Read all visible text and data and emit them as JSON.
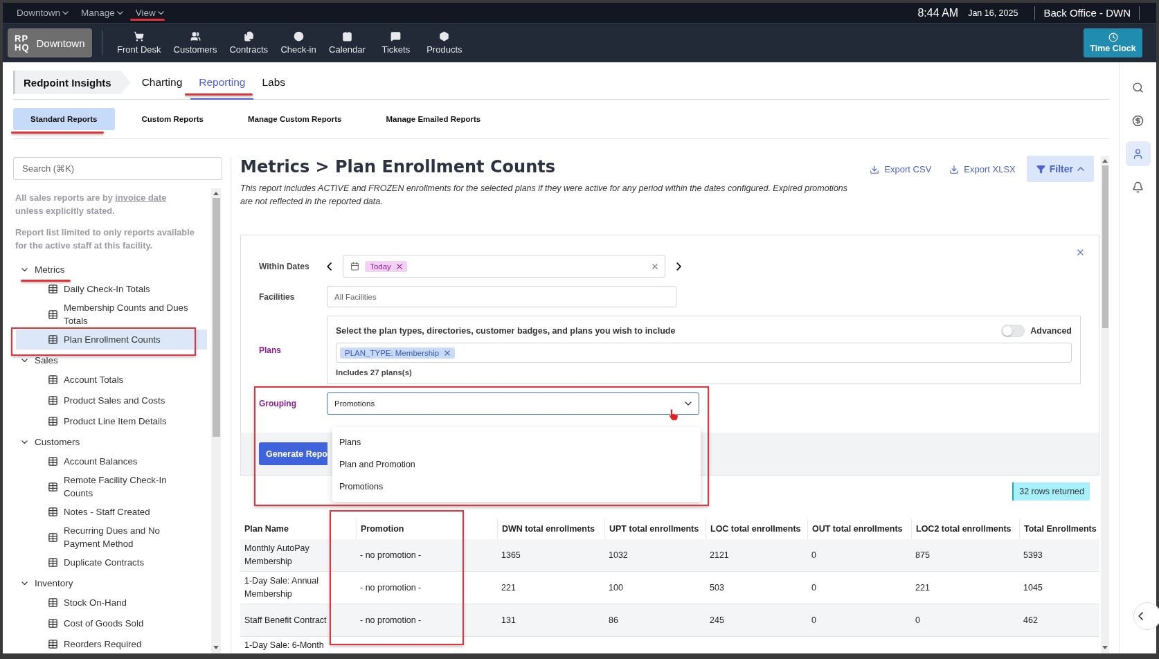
{
  "top_menu": [
    "Downtown",
    "Manage",
    "View"
  ],
  "clock": {
    "time": "8:44 AM",
    "date": "Jan 16, 2025"
  },
  "location": "Back Office - DWN",
  "brand": {
    "logo_top": "RP",
    "logo_bottom": "HQ",
    "name": "Downtown"
  },
  "nav": [
    "Front Desk",
    "Customers",
    "Contracts",
    "Check-in",
    "Calendar",
    "Tickets",
    "Products"
  ],
  "time_clock": "Time Clock",
  "rail": [
    {
      "selected": false
    },
    {
      "selected": false
    },
    {
      "selected": true
    },
    {
      "selected": false
    }
  ],
  "app_tabs": {
    "home": "Redpoint Insights",
    "tabs": [
      {
        "label": "Charting",
        "selected": false
      },
      {
        "label": "Reporting",
        "selected": true
      },
      {
        "label": "Labs",
        "selected": false
      }
    ]
  },
  "sub_tabs": [
    {
      "label": "Standard Reports",
      "selected": true
    },
    {
      "label": "Custom Reports",
      "selected": false
    },
    {
      "label": "Manage Custom Reports",
      "selected": false
    },
    {
      "label": "Manage Emailed Reports",
      "selected": false
    }
  ],
  "sidebar": {
    "search_placeholder": "Search (⌘K)",
    "note_1": {
      "before": "All sales reports are by ",
      "link": "invoice date",
      "after": " unless explicitly stated."
    },
    "note_2": "Report list limited to only reports available for the active staff at this facility.",
    "tree": [
      {
        "label": "Metrics",
        "expanded": true,
        "children": [
          {
            "label": "Daily Check-In Totals",
            "selected": false
          },
          {
            "label": "Membership Counts and Dues Totals",
            "selected": false
          },
          {
            "label": "Plan Enrollment Counts",
            "selected": true
          }
        ]
      },
      {
        "label": "Sales",
        "expanded": true,
        "children": [
          {
            "label": "Account Totals",
            "selected": false
          },
          {
            "label": "Product Sales and Costs",
            "selected": false
          },
          {
            "label": "Product Line Item Details",
            "selected": false
          }
        ]
      },
      {
        "label": "Customers",
        "expanded": true,
        "children": [
          {
            "label": "Account Balances",
            "selected": false
          },
          {
            "label": "Remote Facility Check-In Counts",
            "selected": false
          },
          {
            "label": "Notes - Staff Created",
            "selected": false
          },
          {
            "label": "Recurring Dues and No Payment Method",
            "selected": false
          },
          {
            "label": "Duplicate Contracts",
            "selected": false
          }
        ]
      },
      {
        "label": "Inventory",
        "expanded": true,
        "children": [
          {
            "label": "Stock On-Hand",
            "selected": false
          },
          {
            "label": "Cost of Goods Sold",
            "selected": false
          },
          {
            "label": "Reorders Required",
            "selected": false
          }
        ]
      }
    ]
  },
  "report": {
    "title": "Metrics > Plan Enrollment Counts",
    "description": "This report includes ACTIVE and FROZEN enrollments for the selected plans if they were active for any period within the dates configured. Expired promotions are not reflected in the reported data.",
    "actions": [
      "Export CSV",
      "Export XLSX"
    ],
    "filter_button": {
      "label": "Filter",
      "expanded": true
    }
  },
  "filters": {
    "within_dates": {
      "label": "Within Dates",
      "chip": "Today"
    },
    "facilities": {
      "label": "Facilities",
      "placeholder": "All Facilities"
    },
    "plans": {
      "label": "Plans",
      "prompt": "Select the plan types, directories, customer badges, and plans you wish to include",
      "advanced": {
        "label": "Advanced",
        "on": false
      },
      "chip": "PLAN_TYPE: Membership",
      "summary": "Includes 27 plans(s)"
    },
    "grouping": {
      "label": "Grouping",
      "value": "Promotions",
      "expanded": true,
      "options": [
        "Plans",
        "Plan and Promotion",
        "Promotions"
      ]
    },
    "generate_button": "Generate Repo"
  },
  "rows_returned": "32 rows returned",
  "table": {
    "columns": [
      "Plan Name",
      "Promotion",
      "DWN total enrollments",
      "UPT total enrollments",
      "LOC total enrollments",
      "OUT total enrollments",
      "LOC2 total enrollments",
      "Total Enrollments"
    ],
    "rows": [
      [
        "Monthly AutoPay Membership",
        "- no promotion -",
        "1365",
        "1032",
        "2121",
        "0",
        "875",
        "5393"
      ],
      [
        "1-Day Sale: Annual Membership",
        "- no promotion -",
        "221",
        "100",
        "503",
        "0",
        "221",
        "1045"
      ],
      [
        "Staff Benefit Contract",
        "- no promotion -",
        "131",
        "86",
        "245",
        "0",
        "0",
        "462"
      ],
      [
        "1-Day Sale: 6-Month"
      ]
    ]
  }
}
